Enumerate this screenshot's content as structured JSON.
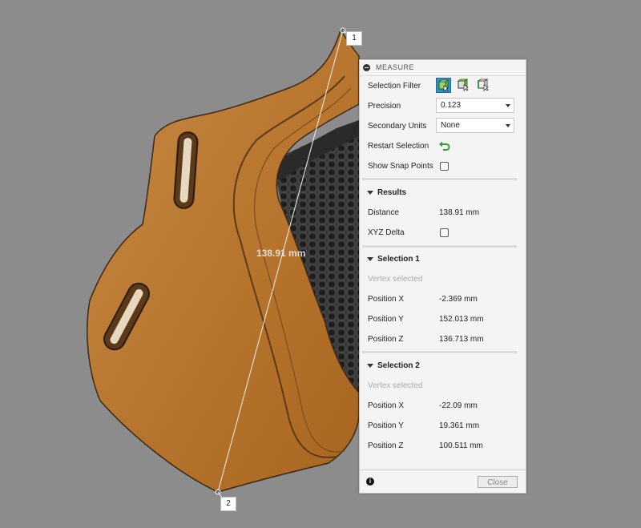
{
  "viewport": {
    "measurement_overlay": "138.91 mm",
    "point1_label": "1",
    "point2_label": "2"
  },
  "panel": {
    "title": "MEASURE",
    "selection_filter_label": "Selection Filter",
    "precision_label": "Precision",
    "precision_value": "0.123",
    "secondary_units_label": "Secondary Units",
    "secondary_units_value": "None",
    "restart_selection_label": "Restart Selection",
    "show_snap_points_label": "Show Snap Points",
    "show_snap_points_checked": false
  },
  "results": {
    "title": "Results",
    "distance_label": "Distance",
    "distance_value": "138.91 mm",
    "xyz_delta_label": "XYZ Delta",
    "xyz_delta_checked": false
  },
  "selection1": {
    "title": "Selection 1",
    "status": "Vertex selected",
    "x_label": "Position X",
    "x_value": "-2.369 mm",
    "y_label": "Position Y",
    "y_value": "152.013 mm",
    "z_label": "Position Z",
    "z_value": "136.713 mm"
  },
  "selection2": {
    "title": "Selection 2",
    "status": "Vertex selected",
    "x_label": "Position X",
    "x_value": "-22.09 mm",
    "y_label": "Position Y",
    "y_value": "19.361 mm",
    "z_label": "Position Z",
    "z_value": "100.511 mm"
  },
  "footer": {
    "info_icon": "info-icon",
    "close_label": "Close"
  },
  "colors": {
    "background": "#8c8c8c",
    "model_orange": "#b87333",
    "active_filter_blue": "#2b93c9",
    "restart_green": "#3a9a3a"
  }
}
